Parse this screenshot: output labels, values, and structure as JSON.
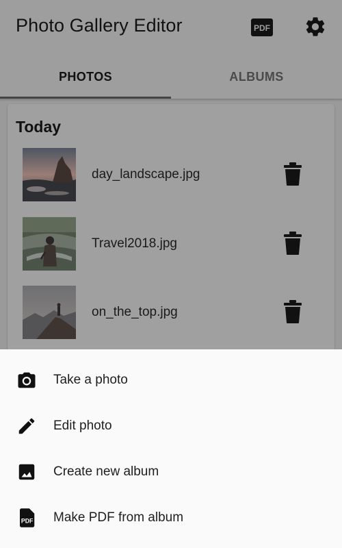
{
  "app": {
    "title": "Photo Gallery Editor",
    "actions": {
      "pdf_icon": "pdf-icon",
      "settings_icon": "gear-icon",
      "pdf_badge_text": "PDF"
    }
  },
  "tabs": [
    {
      "label": "PHOTOS",
      "selected": true
    },
    {
      "label": "ALBUMS",
      "selected": false
    }
  ],
  "section": {
    "title": "Today"
  },
  "photos": [
    {
      "file": "day_landscape.jpg",
      "thumb": "coastal-sunset-rocks"
    },
    {
      "file": "Travel2018.jpg",
      "thumb": "traveler-at-fountain"
    },
    {
      "file": "on_the_top.jpg",
      "thumb": "hiker-on-mountain-peak"
    }
  ],
  "sheet": {
    "items": [
      {
        "label": "Take a photo",
        "icon": "camera-icon"
      },
      {
        "label": "Edit photo",
        "icon": "pencil-icon"
      },
      {
        "label": "Create new album",
        "icon": "image-album-icon"
      },
      {
        "label": "Make PDF from album",
        "icon": "pdf-file-icon"
      }
    ]
  },
  "colors": {
    "scrim": "#9e9e9e",
    "sheet_bg": "#fafafa",
    "text_dark": "#111111",
    "tab_indicator": "#444444"
  }
}
